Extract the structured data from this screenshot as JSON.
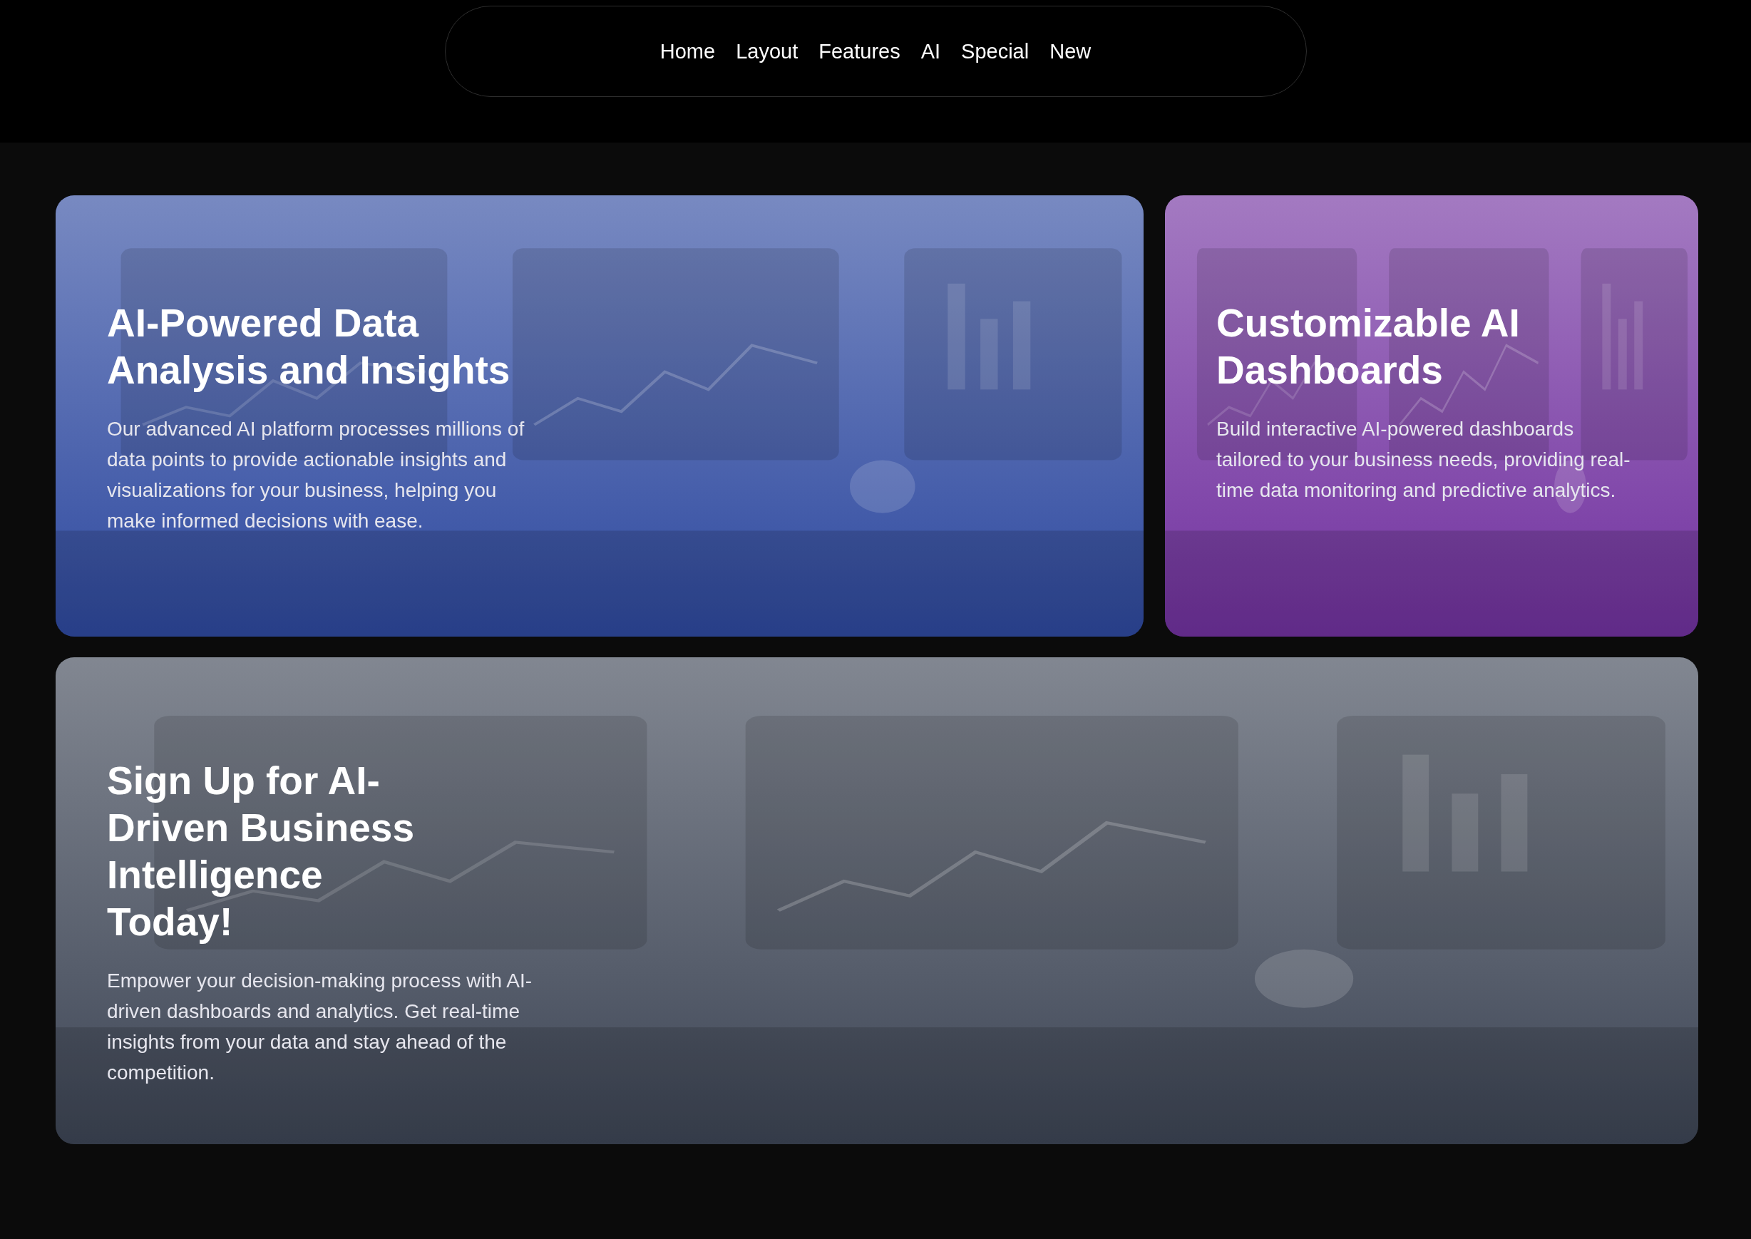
{
  "nav": {
    "items": [
      {
        "label": "Home"
      },
      {
        "label": "Layout"
      },
      {
        "label": "Features"
      },
      {
        "label": "AI"
      },
      {
        "label": "Special"
      },
      {
        "label": "New"
      }
    ]
  },
  "cards": [
    {
      "kind": "wide",
      "title": "AI-Powered Data Analysis and Insights",
      "body": "Our advanced AI platform processes millions of data points to provide actionable insights and visualizations for your business, helping you make informed decisions with ease."
    },
    {
      "kind": "narrow",
      "title": "Customizable AI Dashboards",
      "body": "Build interactive AI-powered dashboards tailored to your business needs, providing real-time data monitoring and predictive analytics."
    },
    {
      "kind": "full",
      "title": "Sign Up for AI-Driven Business Intelligence Today!",
      "body": "Empower your decision-making process with AI-driven dashboards and analytics. Get real-time insights from your data and stay ahead of the competition."
    }
  ]
}
